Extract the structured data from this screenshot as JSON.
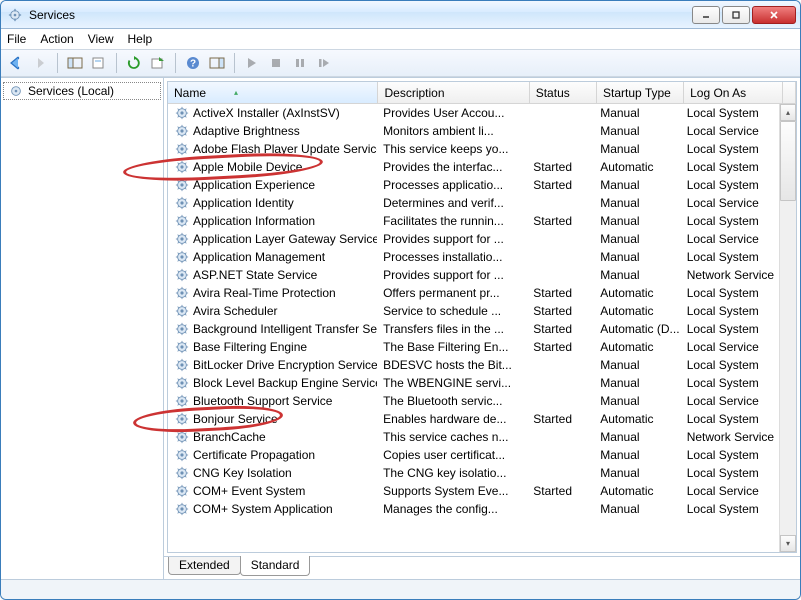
{
  "window": {
    "title": "Services"
  },
  "menu": [
    "File",
    "Action",
    "View",
    "Help"
  ],
  "leftpane": {
    "label": "Services (Local)"
  },
  "columns": {
    "name": "Name",
    "description": "Description",
    "status": "Status",
    "startup": "Startup Type",
    "logon": "Log On As"
  },
  "tabs": {
    "extended": "Extended",
    "standard": "Standard"
  },
  "services": [
    {
      "name": "ActiveX Installer (AxInstSV)",
      "desc": "Provides User Accou...",
      "status": "",
      "startup": "Manual",
      "logon": "Local System"
    },
    {
      "name": "Adaptive Brightness",
      "desc": "Monitors ambient li...",
      "status": "",
      "startup": "Manual",
      "logon": "Local Service"
    },
    {
      "name": "Adobe Flash Player Update Service",
      "desc": "This service keeps yo...",
      "status": "",
      "startup": "Manual",
      "logon": "Local System"
    },
    {
      "name": "Apple Mobile Device",
      "desc": "Provides the interfac...",
      "status": "Started",
      "startup": "Automatic",
      "logon": "Local System"
    },
    {
      "name": "Application Experience",
      "desc": "Processes applicatio...",
      "status": "Started",
      "startup": "Manual",
      "logon": "Local System"
    },
    {
      "name": "Application Identity",
      "desc": "Determines and verif...",
      "status": "",
      "startup": "Manual",
      "logon": "Local Service"
    },
    {
      "name": "Application Information",
      "desc": "Facilitates the runnin...",
      "status": "Started",
      "startup": "Manual",
      "logon": "Local System"
    },
    {
      "name": "Application Layer Gateway Service",
      "desc": "Provides support for ...",
      "status": "",
      "startup": "Manual",
      "logon": "Local Service"
    },
    {
      "name": "Application Management",
      "desc": "Processes installatio...",
      "status": "",
      "startup": "Manual",
      "logon": "Local System"
    },
    {
      "name": "ASP.NET State Service",
      "desc": "Provides support for ...",
      "status": "",
      "startup": "Manual",
      "logon": "Network Service"
    },
    {
      "name": "Avira Real-Time Protection",
      "desc": "Offers permanent pr...",
      "status": "Started",
      "startup": "Automatic",
      "logon": "Local System"
    },
    {
      "name": "Avira Scheduler",
      "desc": "Service to schedule ...",
      "status": "Started",
      "startup": "Automatic",
      "logon": "Local System"
    },
    {
      "name": "Background Intelligent Transfer Service",
      "desc": "Transfers files in the ...",
      "status": "Started",
      "startup": "Automatic (D...",
      "logon": "Local System"
    },
    {
      "name": "Base Filtering Engine",
      "desc": "The Base Filtering En...",
      "status": "Started",
      "startup": "Automatic",
      "logon": "Local Service"
    },
    {
      "name": "BitLocker Drive Encryption Service",
      "desc": "BDESVC hosts the Bit...",
      "status": "",
      "startup": "Manual",
      "logon": "Local System"
    },
    {
      "name": "Block Level Backup Engine Service",
      "desc": "The WBENGINE servi...",
      "status": "",
      "startup": "Manual",
      "logon": "Local System"
    },
    {
      "name": "Bluetooth Support Service",
      "desc": "The Bluetooth servic...",
      "status": "",
      "startup": "Manual",
      "logon": "Local Service"
    },
    {
      "name": "Bonjour Service",
      "desc": "Enables hardware de...",
      "status": "Started",
      "startup": "Automatic",
      "logon": "Local System"
    },
    {
      "name": "BranchCache",
      "desc": "This service caches n...",
      "status": "",
      "startup": "Manual",
      "logon": "Network Service"
    },
    {
      "name": "Certificate Propagation",
      "desc": "Copies user certificat...",
      "status": "",
      "startup": "Manual",
      "logon": "Local System"
    },
    {
      "name": "CNG Key Isolation",
      "desc": "The CNG key isolatio...",
      "status": "",
      "startup": "Manual",
      "logon": "Local System"
    },
    {
      "name": "COM+ Event System",
      "desc": "Supports System Eve...",
      "status": "Started",
      "startup": "Automatic",
      "logon": "Local Service"
    },
    {
      "name": "COM+ System Application",
      "desc": "Manages the config...",
      "status": "",
      "startup": "Manual",
      "logon": "Local System"
    }
  ]
}
